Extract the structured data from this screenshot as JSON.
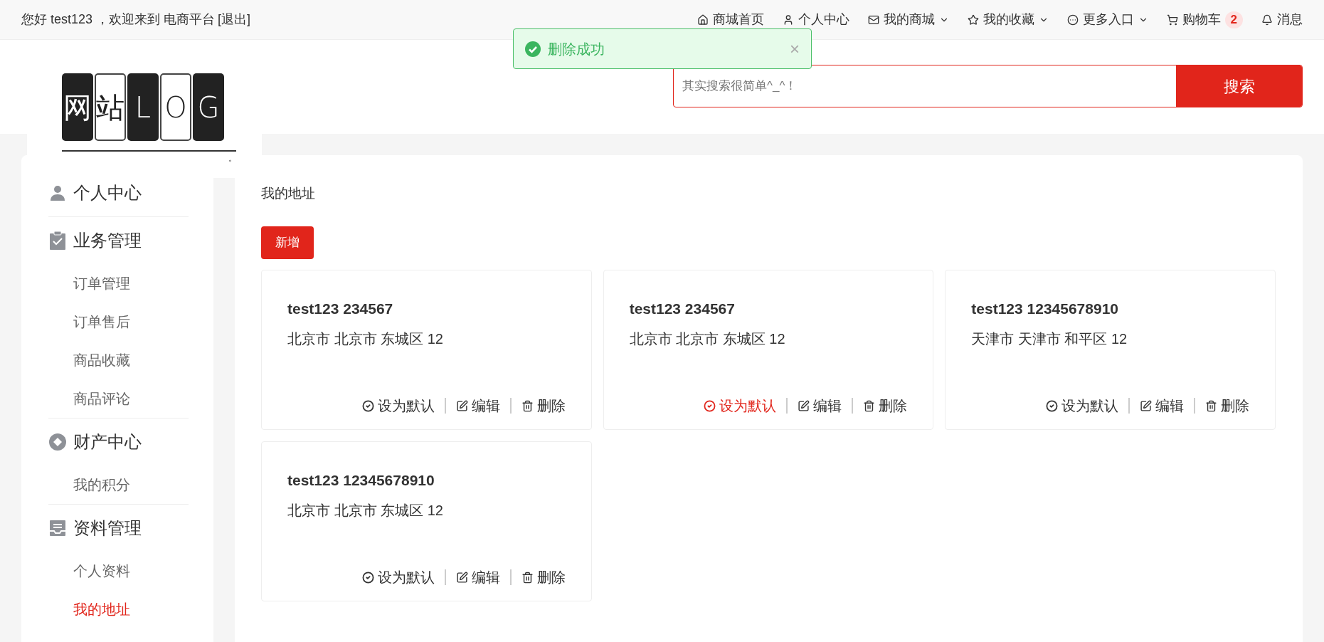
{
  "topbar": {
    "greeting": "您好 test123 ，欢迎来到 电商平台",
    "logout": "[退出]",
    "nav": [
      {
        "kind": "home",
        "label": "商城首页"
      },
      {
        "kind": "user",
        "label": "个人中心"
      },
      {
        "kind": "shop",
        "label": "我的商城",
        "caret": true
      },
      {
        "kind": "star",
        "label": "我的收藏",
        "caret": true
      },
      {
        "kind": "more",
        "label": "更多入口",
        "caret": true
      },
      {
        "kind": "cart",
        "label": "购物车",
        "badge": "2"
      },
      {
        "kind": "bell",
        "label": "消息"
      }
    ]
  },
  "toast": {
    "message": "删除成功",
    "close": "×"
  },
  "logo": {
    "tiles": [
      {
        "char": "网",
        "dark": true
      },
      {
        "char": "站",
        "dark": false
      },
      {
        "char": "L",
        "dark": true
      },
      {
        "char": "O",
        "dark": false
      },
      {
        "char": "G",
        "dark": true
      }
    ],
    "mark": "。"
  },
  "search": {
    "placeholder": "其实搜索很简单^_^！",
    "button": "搜索"
  },
  "sidebar": {
    "groups": [
      {
        "title": "个人中心"
      },
      {
        "title": "业务管理",
        "items": [
          {
            "label": "订单管理",
            "selected": false
          },
          {
            "label": "订单售后",
            "selected": false
          },
          {
            "label": "商品收藏",
            "selected": false
          },
          {
            "label": "商品评论",
            "selected": false
          }
        ]
      },
      {
        "title": "财产中心",
        "items": [
          {
            "label": "我的积分",
            "selected": false
          }
        ]
      },
      {
        "title": "资料管理",
        "items": [
          {
            "label": "个人资料",
            "selected": false
          },
          {
            "label": "我的地址",
            "selected": true
          }
        ]
      }
    ]
  },
  "content": {
    "title": "我的地址",
    "add_button": "新增",
    "addresses": [
      {
        "name": "test123 234567",
        "address": "北京市 北京市 东城区 12",
        "is_default": false,
        "set_default": "设为默认",
        "edit": "编辑",
        "delete": "删除"
      },
      {
        "name": "test123 234567",
        "address": "北京市 北京市 东城区 12",
        "is_default": true,
        "set_default": "设为默认",
        "edit": "编辑",
        "delete": "删除"
      },
      {
        "name": "test123 12345678910",
        "address": "天津市 天津市 和平区 12",
        "is_default": false,
        "set_default": "设为默认",
        "edit": "编辑",
        "delete": "删除"
      },
      {
        "name": "test123 12345678910",
        "address": "北京市 北京市 东城区 12",
        "is_default": false,
        "set_default": "设为默认",
        "edit": "编辑",
        "delete": "删除"
      }
    ]
  }
}
